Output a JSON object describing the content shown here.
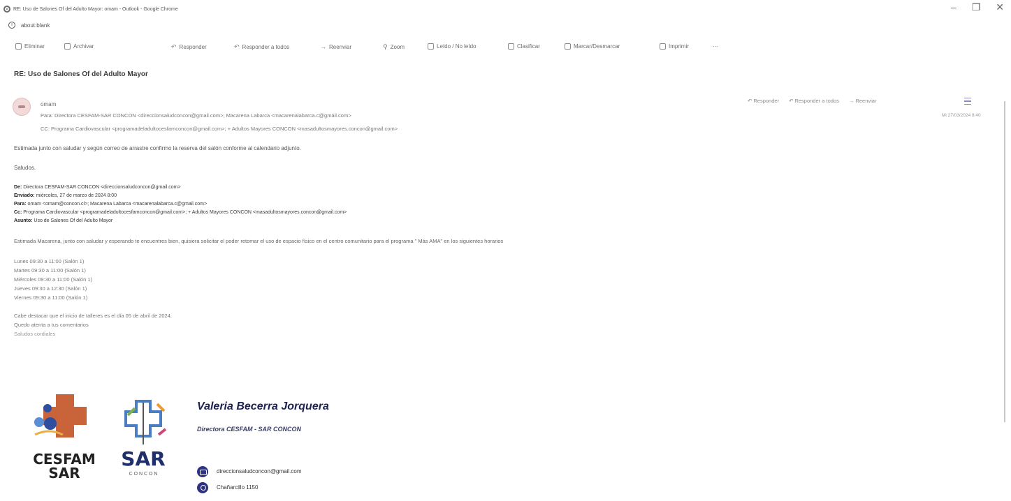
{
  "window": {
    "title": "RE: Uso de Salones Of del Adulto Mayor: omam - Outlook - Google Chrome",
    "controls": {
      "minimize": "–",
      "restore": "❐",
      "close": "✕"
    }
  },
  "address": {
    "url": "about:blank"
  },
  "toolbar": {
    "delete": "Eliminar",
    "archive": "Archivar",
    "reply": "Responder",
    "reply_all": "Responder a todos",
    "forward": "Reenviar",
    "zoom": "Zoom",
    "read_unread": "Leído / No leído",
    "categorize": "Clasificar",
    "flag": "Marcar/Desmarcar",
    "print": "Imprimir",
    "more": "···"
  },
  "email": {
    "subject": "RE: Uso de Salones Of del Adulto Mayor",
    "sender": "omam",
    "to": "Para: Directora CESFAM-SAR CONCON <direccionsaludconcon@gmail.com>;  Macarena Labarca <macarenalabarca.c@gmail.com>",
    "cc": "CC: Programa Cardiovascular <programadeladultocesfamconcon@gmail.com>;  + Adultos Mayores CONCON <masadultosmayores.concon@gmail.com>",
    "date": "Mi 27/03/2024 8:40",
    "actions": {
      "reply": "Responder",
      "reply_all": "Responder a todos",
      "forward": "Reenviar"
    },
    "body_line1": "Estimada junto con saludar y según correo de arrastre confirmo la reserva del salón conforme al calendario adjunto.",
    "body_line2": "Saludos.",
    "quoted": {
      "from_label": "De:",
      "from": "Directora CESFAM-SAR CONCON <direccionsaludconcon@gmail.com>",
      "sent_label": "Enviado:",
      "sent": "miércoles, 27 de marzo de 2024 8:00",
      "to_label": "Para:",
      "to": "omam <omam@concon.cl>; Macarena Labarca <macarenalabarca.c@gmail.com>",
      "cc_label": "Cc:",
      "cc": "Programa Cardiovascular <programadeladultocesfamconcon@gmail.com>; + Adultos Mayores CONCON <masadultosmayores.concon@gmail.com>",
      "subject_label": "Asunto:",
      "subject": "Uso de Salones Of del Adulto Mayor",
      "intro": "Estimada Macarena, junto con saludar y esperando te encuentres bien, quisiera solicitar el poder retomar el uso de espacio físico en el centro comunitario para el programa \" Más AMA\" en los siguientes horarios",
      "schedule": [
        "Lunes 09:30 a 11:00 (Salón 1)",
        "Martes  09:30 a 11:00 (Salón 1)",
        "Miércoles  09:30 a 11:00 (Salón 1)",
        "Jueves 09:30 a 12:30 (Salón 1)",
        "Viernes  09:30 a 11:00 (Salón 1)"
      ],
      "closing": [
        "Cabe destacar que el inicio de talleres es el día 05 de abril de 2024.",
        "Quedo atenta a tus comentarios",
        "Saludos cordiales"
      ]
    },
    "signature": {
      "name": "Valeria Becerra Jorquera",
      "title": "Directora CESFAM - SAR CONCON",
      "email": "direccionsaludconcon@gmail.com",
      "address": "Chañarcillo 1150",
      "logo1_text_top": "CESFAM",
      "logo1_text_bottom": "SAR",
      "logo2_text": "SAR",
      "logo2_sub": "C O N C O N"
    }
  }
}
